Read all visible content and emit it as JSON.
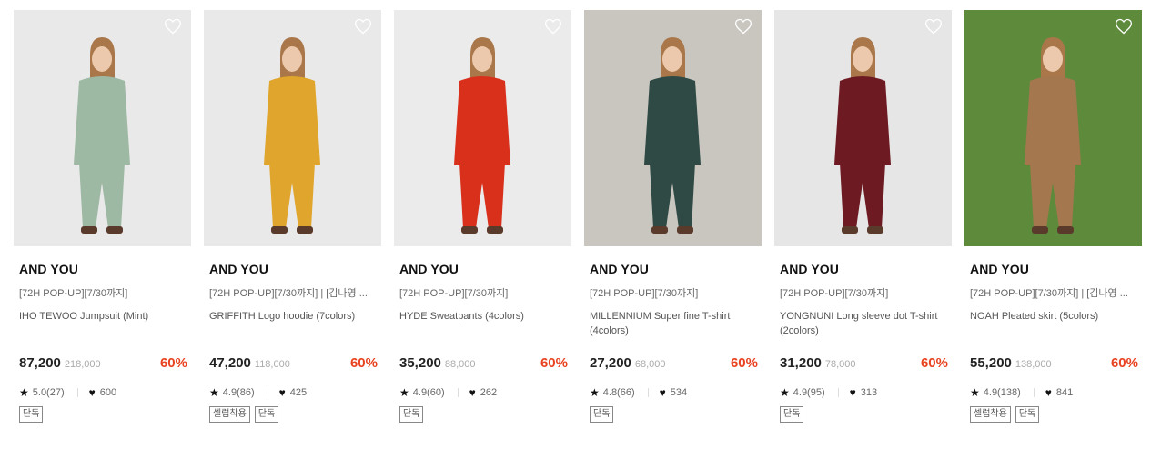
{
  "products": [
    {
      "brand": "AND YOU",
      "tag": "[72H POP-UP][7/30까지]",
      "name": "IHO TEWOO Jumpsuit (Mint)",
      "price": "87,200",
      "original_price": "218,000",
      "discount": "60%",
      "rating": "5.0(27)",
      "likes": "600",
      "badges": [
        "단독"
      ],
      "bg": "#e9e9ea",
      "figure_color": "#9db8a3",
      "liked": false
    },
    {
      "brand": "AND YOU",
      "tag": "[72H POP-UP][7/30까지] | [김나영 ...",
      "name": "GRIFFITH Logo hoodie (7colors)",
      "price": "47,200",
      "original_price": "118,000",
      "discount": "60%",
      "rating": "4.9(86)",
      "likes": "425",
      "badges": [
        "셀럽착용",
        "단독"
      ],
      "bg": "#e9e9ea",
      "figure_color": "#e0a52c",
      "liked": false
    },
    {
      "brand": "AND YOU",
      "tag": "[72H POP-UP][7/30까지]",
      "name": "HYDE Sweatpants (4colors)",
      "price": "35,200",
      "original_price": "88,000",
      "discount": "60%",
      "rating": "4.9(60)",
      "likes": "262",
      "badges": [
        "단독"
      ],
      "bg": "#ebebec",
      "figure_color": "#d9301c",
      "liked": false
    },
    {
      "brand": "AND YOU",
      "tag": "[72H POP-UP][7/30까지]",
      "name": "MILLENNIUM Super fine T-shirt (4colors)",
      "price": "27,200",
      "original_price": "68,000",
      "discount": "60%",
      "rating": "4.8(66)",
      "likes": "534",
      "badges": [
        "단독"
      ],
      "bg": "#c9c6c0",
      "figure_color": "#2f4a45",
      "liked": false
    },
    {
      "brand": "AND YOU",
      "tag": "[72H POP-UP][7/30까지]",
      "name": "YONGNUNI Long sleeve dot T-shirt (2colors)",
      "price": "31,200",
      "original_price": "78,000",
      "discount": "60%",
      "rating": "4.9(95)",
      "likes": "313",
      "badges": [
        "단독"
      ],
      "bg": "#e6e6e7",
      "figure_color": "#6e1a22",
      "liked": false
    },
    {
      "brand": "AND YOU",
      "tag": "[72H POP-UP][7/30까지] | [김나영 ...",
      "name": "NOAH Pleated skirt (5colors)",
      "price": "55,200",
      "original_price": "138,000",
      "discount": "60%",
      "rating": "4.9(138)",
      "likes": "841",
      "badges": [
        "셀럽착용",
        "단독"
      ],
      "bg": "#5e8a3c",
      "figure_color": "#a4774f",
      "liked": false
    }
  ],
  "icons": {
    "wishlist": "heart-outline-icon",
    "rating": "star-icon",
    "likes": "heart-filled-icon"
  },
  "colors": {
    "discount": "#e8421f",
    "price": "#222222",
    "original_price": "#aaaaaa"
  }
}
